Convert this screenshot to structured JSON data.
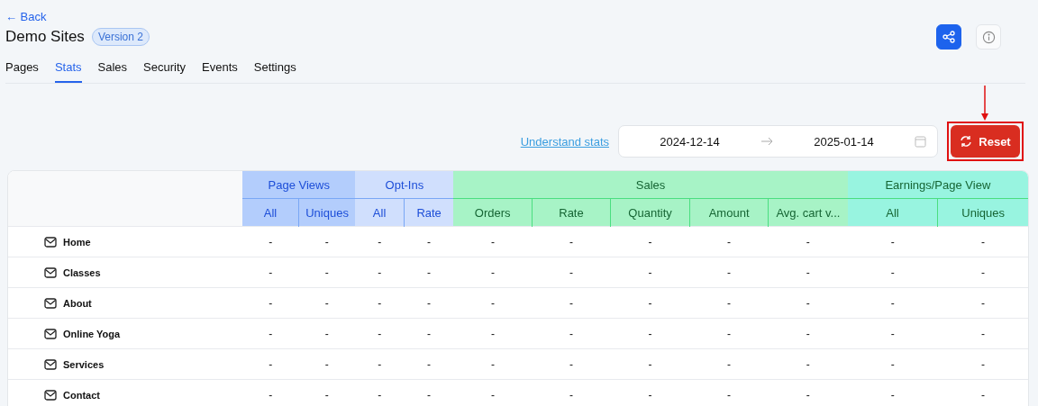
{
  "back_link": "← Back",
  "site": {
    "title": "Demo Sites",
    "version_badge": "Version 2"
  },
  "tabs": [
    {
      "label": "Pages",
      "selected": false
    },
    {
      "label": "Stats",
      "selected": true
    },
    {
      "label": "Sales",
      "selected": false
    },
    {
      "label": "Security",
      "selected": false
    },
    {
      "label": "Events",
      "selected": false
    },
    {
      "label": "Settings",
      "selected": false
    }
  ],
  "toolbar": {
    "help_link": "Understand stats",
    "date_from": "2024-12-14",
    "date_to": "2025-01-14",
    "reset_button": {
      "label": "Reset",
      "highlighted": true
    }
  },
  "table": {
    "groups": [
      {
        "label": "Page Views",
        "color": "#b3cdfc",
        "kind": "traffic",
        "columns": [
          "All",
          "Uniques"
        ]
      },
      {
        "label": "Opt-Ins",
        "color": "#d0dffd",
        "kind": "traffic",
        "columns": [
          "All",
          "Rate"
        ]
      },
      {
        "label": "Sales",
        "color": "#a7f3c6",
        "kind": "money",
        "columns": [
          "Orders",
          "Rate",
          "Quantity",
          "Amount",
          "Avg. cart v..."
        ]
      },
      {
        "label": "Earnings/Page View",
        "color": "#98f4e0",
        "kind": "money",
        "columns": [
          "All",
          "Uniques"
        ]
      }
    ],
    "rows": [
      {
        "page": "Home",
        "cells": [
          "-",
          "-",
          "-",
          "-",
          "-",
          "-",
          "-",
          "-",
          "-",
          "-",
          "-"
        ]
      },
      {
        "page": "Classes",
        "cells": [
          "-",
          "-",
          "-",
          "-",
          "-",
          "-",
          "-",
          "-",
          "-",
          "-",
          "-"
        ]
      },
      {
        "page": "About",
        "cells": [
          "-",
          "-",
          "-",
          "-",
          "-",
          "-",
          "-",
          "-",
          "-",
          "-",
          "-"
        ]
      },
      {
        "page": "Online Yoga",
        "cells": [
          "-",
          "-",
          "-",
          "-",
          "-",
          "-",
          "-",
          "-",
          "-",
          "-",
          "-"
        ]
      },
      {
        "page": "Services",
        "cells": [
          "-",
          "-",
          "-",
          "-",
          "-",
          "-",
          "-",
          "-",
          "-",
          "-",
          "-"
        ]
      },
      {
        "page": "Contact",
        "cells": [
          "-",
          "-",
          "-",
          "-",
          "-",
          "-",
          "-",
          "-",
          "-",
          "-",
          "-"
        ]
      }
    ]
  }
}
